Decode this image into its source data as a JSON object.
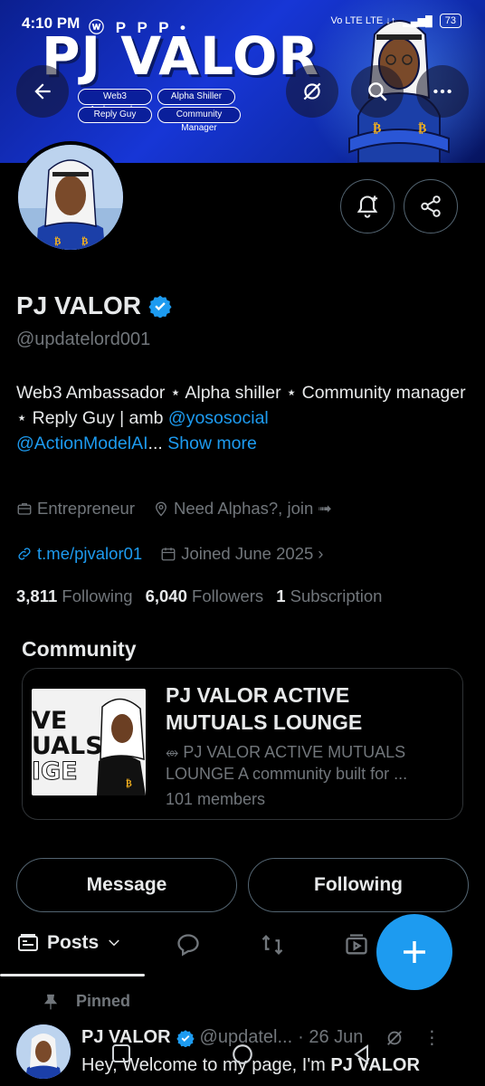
{
  "status": {
    "time": "4:10 PM",
    "notif_icons": "ⓦ P P P •",
    "network": "Vo LTE  LTE ↓↑",
    "battery": "73"
  },
  "banner": {
    "title": "PJ VALOR",
    "pills": [
      "Web3 Ambassador",
      "Alpha Shiller",
      "Reply Guy",
      "Community Manager"
    ]
  },
  "profile": {
    "name": "PJ VALOR",
    "handle": "@updatelord001",
    "bio_prefix": "Web3 Ambassador ⋆ Alpha shiller ⋆ Community manager ⋆  Reply Guy | amb ",
    "bio_mention1": "@yososocial",
    "bio_mention2": "@ActionModelAI",
    "bio_ellipsis": "...",
    "show_more": "Show more",
    "profession": "Entrepreneur",
    "location": "Need Alphas?, join ➟",
    "url": "t.me/pjvalor01",
    "joined": "Joined June 2025",
    "following_count": "3,811",
    "following_label": "Following",
    "followers_count": "6,040",
    "followers_label": "Followers",
    "subscription_count": "1",
    "subscription_label": "Subscription"
  },
  "community": {
    "section_label": "Community",
    "title": "PJ VALOR ACTIVE MUTUALS LOUNGE",
    "description": "⥈ PJ VALOR ACTIVE MUTUALS LOUNGE A community built for ...",
    "members": "101 members",
    "thumb_text": [
      "VE",
      "UALS",
      "IGE"
    ]
  },
  "actions": {
    "message": "Message",
    "following": "Following"
  },
  "tabs": {
    "posts": "Posts"
  },
  "pinned": {
    "label": "Pinned",
    "name": "PJ VALOR",
    "handle": "@updatel...",
    "date": "· 26 Jun",
    "text_prefix": "Hey, Welcome to my page,  I'm ",
    "text_name": "PJ VALOR"
  },
  "colors": {
    "accent": "#1d9bf0",
    "banner": "#1736d6",
    "background": "#000000"
  }
}
